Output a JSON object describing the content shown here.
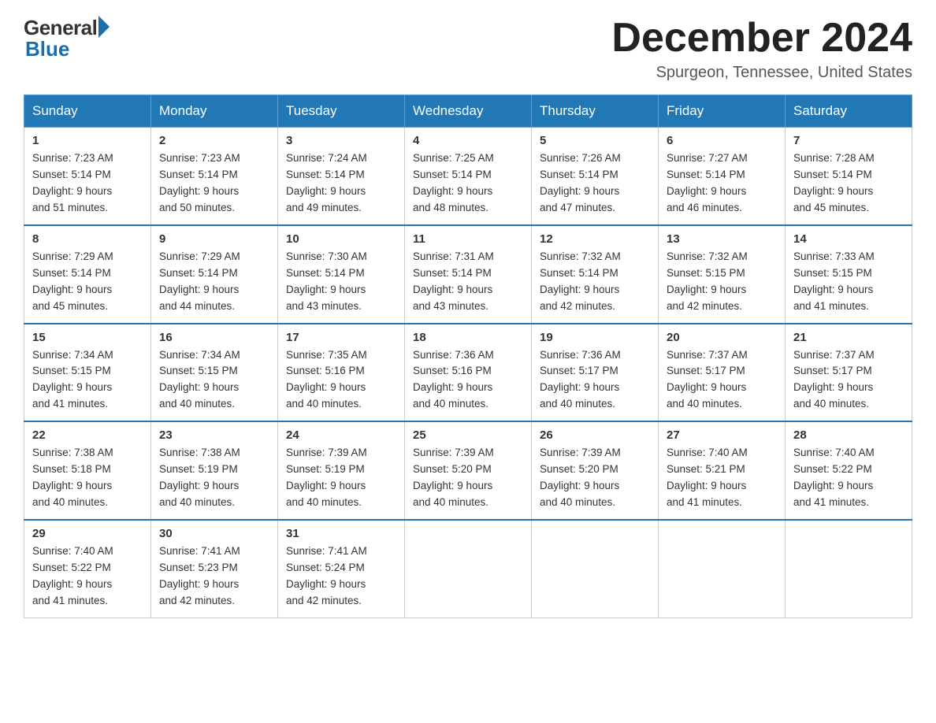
{
  "header": {
    "logo_general": "General",
    "logo_blue": "Blue",
    "month_title": "December 2024",
    "location": "Spurgeon, Tennessee, United States"
  },
  "weekdays": [
    "Sunday",
    "Monday",
    "Tuesday",
    "Wednesday",
    "Thursday",
    "Friday",
    "Saturday"
  ],
  "weeks": [
    [
      {
        "day": "1",
        "sunrise": "7:23 AM",
        "sunset": "5:14 PM",
        "daylight": "9 hours and 51 minutes."
      },
      {
        "day": "2",
        "sunrise": "7:23 AM",
        "sunset": "5:14 PM",
        "daylight": "9 hours and 50 minutes."
      },
      {
        "day": "3",
        "sunrise": "7:24 AM",
        "sunset": "5:14 PM",
        "daylight": "9 hours and 49 minutes."
      },
      {
        "day": "4",
        "sunrise": "7:25 AM",
        "sunset": "5:14 PM",
        "daylight": "9 hours and 48 minutes."
      },
      {
        "day": "5",
        "sunrise": "7:26 AM",
        "sunset": "5:14 PM",
        "daylight": "9 hours and 47 minutes."
      },
      {
        "day": "6",
        "sunrise": "7:27 AM",
        "sunset": "5:14 PM",
        "daylight": "9 hours and 46 minutes."
      },
      {
        "day": "7",
        "sunrise": "7:28 AM",
        "sunset": "5:14 PM",
        "daylight": "9 hours and 45 minutes."
      }
    ],
    [
      {
        "day": "8",
        "sunrise": "7:29 AM",
        "sunset": "5:14 PM",
        "daylight": "9 hours and 45 minutes."
      },
      {
        "day": "9",
        "sunrise": "7:29 AM",
        "sunset": "5:14 PM",
        "daylight": "9 hours and 44 minutes."
      },
      {
        "day": "10",
        "sunrise": "7:30 AM",
        "sunset": "5:14 PM",
        "daylight": "9 hours and 43 minutes."
      },
      {
        "day": "11",
        "sunrise": "7:31 AM",
        "sunset": "5:14 PM",
        "daylight": "9 hours and 43 minutes."
      },
      {
        "day": "12",
        "sunrise": "7:32 AM",
        "sunset": "5:14 PM",
        "daylight": "9 hours and 42 minutes."
      },
      {
        "day": "13",
        "sunrise": "7:32 AM",
        "sunset": "5:15 PM",
        "daylight": "9 hours and 42 minutes."
      },
      {
        "day": "14",
        "sunrise": "7:33 AM",
        "sunset": "5:15 PM",
        "daylight": "9 hours and 41 minutes."
      }
    ],
    [
      {
        "day": "15",
        "sunrise": "7:34 AM",
        "sunset": "5:15 PM",
        "daylight": "9 hours and 41 minutes."
      },
      {
        "day": "16",
        "sunrise": "7:34 AM",
        "sunset": "5:15 PM",
        "daylight": "9 hours and 40 minutes."
      },
      {
        "day": "17",
        "sunrise": "7:35 AM",
        "sunset": "5:16 PM",
        "daylight": "9 hours and 40 minutes."
      },
      {
        "day": "18",
        "sunrise": "7:36 AM",
        "sunset": "5:16 PM",
        "daylight": "9 hours and 40 minutes."
      },
      {
        "day": "19",
        "sunrise": "7:36 AM",
        "sunset": "5:17 PM",
        "daylight": "9 hours and 40 minutes."
      },
      {
        "day": "20",
        "sunrise": "7:37 AM",
        "sunset": "5:17 PM",
        "daylight": "9 hours and 40 minutes."
      },
      {
        "day": "21",
        "sunrise": "7:37 AM",
        "sunset": "5:17 PM",
        "daylight": "9 hours and 40 minutes."
      }
    ],
    [
      {
        "day": "22",
        "sunrise": "7:38 AM",
        "sunset": "5:18 PM",
        "daylight": "9 hours and 40 minutes."
      },
      {
        "day": "23",
        "sunrise": "7:38 AM",
        "sunset": "5:19 PM",
        "daylight": "9 hours and 40 minutes."
      },
      {
        "day": "24",
        "sunrise": "7:39 AM",
        "sunset": "5:19 PM",
        "daylight": "9 hours and 40 minutes."
      },
      {
        "day": "25",
        "sunrise": "7:39 AM",
        "sunset": "5:20 PM",
        "daylight": "9 hours and 40 minutes."
      },
      {
        "day": "26",
        "sunrise": "7:39 AM",
        "sunset": "5:20 PM",
        "daylight": "9 hours and 40 minutes."
      },
      {
        "day": "27",
        "sunrise": "7:40 AM",
        "sunset": "5:21 PM",
        "daylight": "9 hours and 41 minutes."
      },
      {
        "day": "28",
        "sunrise": "7:40 AM",
        "sunset": "5:22 PM",
        "daylight": "9 hours and 41 minutes."
      }
    ],
    [
      {
        "day": "29",
        "sunrise": "7:40 AM",
        "sunset": "5:22 PM",
        "daylight": "9 hours and 41 minutes."
      },
      {
        "day": "30",
        "sunrise": "7:41 AM",
        "sunset": "5:23 PM",
        "daylight": "9 hours and 42 minutes."
      },
      {
        "day": "31",
        "sunrise": "7:41 AM",
        "sunset": "5:24 PM",
        "daylight": "9 hours and 42 minutes."
      },
      null,
      null,
      null,
      null
    ]
  ],
  "labels": {
    "sunrise_prefix": "Sunrise: ",
    "sunset_prefix": "Sunset: ",
    "daylight_prefix": "Daylight: "
  }
}
